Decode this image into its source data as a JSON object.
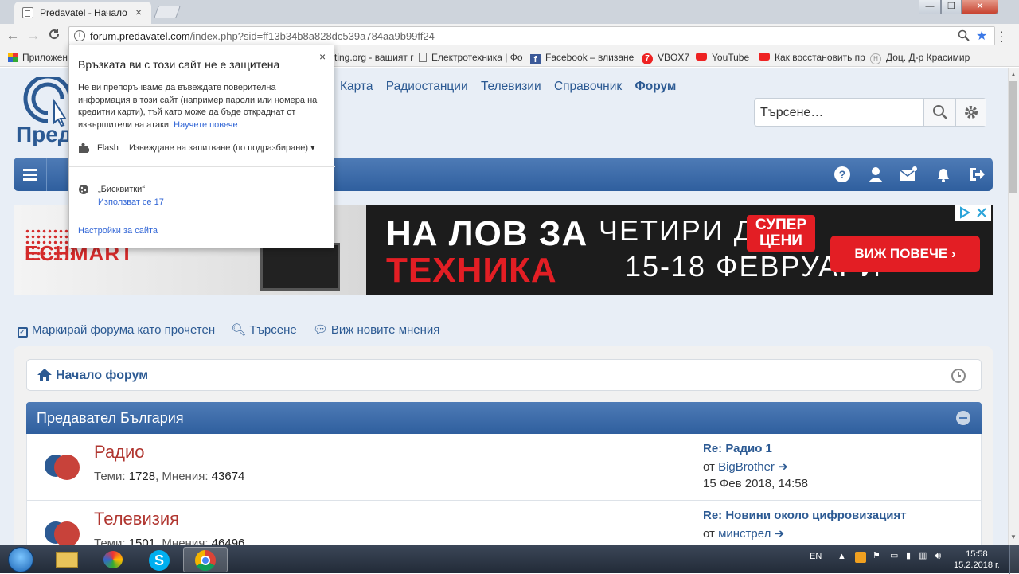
{
  "browser": {
    "tab_title": "Predavatel - Начало",
    "tab_close": "×",
    "window_buttons": {
      "minimize": "—",
      "maximize": "❐",
      "close": "✕"
    },
    "url_domain": "forum.predavatel.com",
    "url_path": "/index.php?sid=ff13b34b8a828dc539a784aa9b99ff24",
    "bookmarks": [
      {
        "label": "Приложения",
        "icon": "apps-icon"
      },
      {
        "label": "ting.org - вашият г",
        "icon": "page-icon"
      },
      {
        "label": "Електротехника | Фо",
        "icon": "page-icon"
      },
      {
        "label": "Facebook – влизане",
        "icon": "facebook-icon"
      },
      {
        "label": "VBOX7",
        "icon": "vbox7-icon"
      },
      {
        "label": "YouTube",
        "icon": "youtube-icon"
      },
      {
        "label": "Как восстановить пр",
        "icon": "youtube-icon"
      },
      {
        "label": "Доц. Д-р Красимир",
        "icon": "h-icon"
      }
    ]
  },
  "popup": {
    "title": "Връзката ви с този сайт не е защитена",
    "description": "Не ви препоръчваме да въвеждате поверителна информация в този сайт (например пароли или номера на кредитни карти), тъй като може да бъде откраднат от извършители на атаки.",
    "learn_more": "Научете повече",
    "flash_label": "Flash",
    "flash_value": "Извеждане на запитване (по подразбиране)",
    "cookies_label": "„Бисквитки“",
    "cookies_value": "Използват се 17",
    "site_settings": "Настройки за сайта",
    "close": "×"
  },
  "site": {
    "logo_text": "Преда",
    "nav": [
      "Карта",
      "Радиостанции",
      "Телевизии",
      "Справочник",
      "Форум"
    ],
    "search_placeholder": "Търсене…",
    "quicklinks": [
      "Маркирай форума като прочетен",
      "Търсене",
      "Виж новите мнения"
    ],
    "breadcrumb": "Начало форум",
    "category": "Предавател България",
    "forums": [
      {
        "title": "Радио",
        "topics_label": "Теми:",
        "topics": "1728",
        "posts_label": "Мнения:",
        "posts": "43674",
        "last_title": "Re: Радио 1",
        "last_by": "от",
        "last_user": "BigBrother",
        "last_date": "15 Фев 2018, 14:58"
      },
      {
        "title": "Телевизия",
        "topics_label": "Теми:",
        "topics": "1501",
        "posts_label": "Мнения:",
        "posts": "46496",
        "last_title": "Re: Новини около цифровизацият",
        "last_by": "от",
        "last_user": "минстрел",
        "last_date": ""
      }
    ]
  },
  "ad": {
    "line1": "НА ЛОВ ЗА",
    "line2": "ТЕХНИКА",
    "line3": "ЧЕТИРИ ДНИ",
    "line4": "15-18 ФЕВРУАРИ",
    "super1": "СУПЕР",
    "super2": "ЦЕНИ",
    "button": "ВИЖ ПОВЕЧЕ",
    "brand": "ECHMART"
  },
  "taskbar": {
    "lang": "EN",
    "time": "15:58",
    "date": "15.2.2018 г."
  },
  "colors": {
    "link": "#2c5a93",
    "forum_title": "#b0352f",
    "nav_gradient_top": "#4e7bb6",
    "ad_red": "#e31e24"
  }
}
